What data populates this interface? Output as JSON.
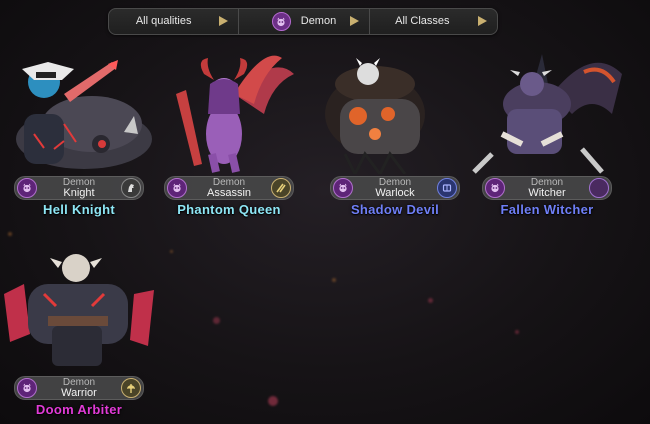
{
  "filters": {
    "quality_label": "All qualities",
    "race_label": "Demon",
    "class_label": "All Classes"
  },
  "heroes": [
    {
      "name": "Hell Knight",
      "race": "Demon",
      "class": "Knight",
      "name_color": "#8ee6f5",
      "class_icon": "horse-icon"
    },
    {
      "name": "Phantom Queen",
      "race": "Demon",
      "class": "Assassin",
      "name_color": "#8ee6f5",
      "class_icon": "daggers-icon"
    },
    {
      "name": "Shadow Devil",
      "race": "Demon",
      "class": "Warlock",
      "name_color": "#6f7ff7",
      "class_icon": "spellbook-icon"
    },
    {
      "name": "Fallen Witcher",
      "race": "Demon",
      "class": "Witcher",
      "name_color": "#6f7ff7",
      "class_icon": "crescent-icon"
    },
    {
      "name": "Doom Arbiter",
      "race": "Demon",
      "class": "Warrior",
      "name_color": "#e23bd8",
      "class_icon": "axe-icon"
    }
  ],
  "colors": {
    "race_badge": "#5e2478",
    "filter_arrow": "#c9b070"
  }
}
